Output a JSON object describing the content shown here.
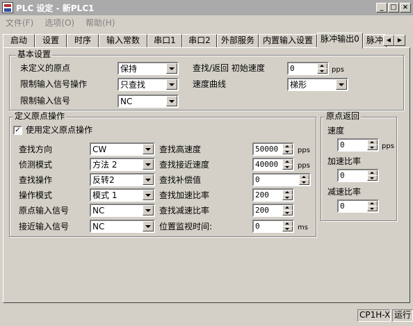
{
  "window": {
    "title": "PLC 设定 - 新PLC1",
    "min_label": "_",
    "max_label": "□",
    "close_label": "×"
  },
  "menu": [
    "文件(F)",
    "选项(O)",
    "帮助(H)"
  ],
  "tabs": [
    "启动",
    "设置",
    "时序",
    "输入常数",
    "串口1",
    "串口2",
    "外部服务",
    "内置输入设置",
    "脉冲输出0",
    "脉冲"
  ],
  "basic": {
    "legend": "基本设置",
    "undefined_origin_label": "未定义的原点",
    "undefined_origin_value": "保持",
    "limit_op_label": "限制输入信号操作",
    "limit_op_value": "只查找",
    "limit_signal_label": "限制输入信号",
    "limit_signal_value": "NC",
    "search_return_label": "查找/返回 初始速度",
    "search_return_value": "0",
    "search_return_unit": "pps",
    "speed_curve_label": "速度曲线",
    "speed_curve_value": "梯形"
  },
  "define": {
    "legend": "定义原点操作",
    "use_check_label": "使用定义原点操作",
    "use_check_mark": "✓",
    "rows": [
      {
        "label": "查找方向",
        "value": "CW"
      },
      {
        "label": "侦测模式",
        "value": "方法 2"
      },
      {
        "label": "查找操作",
        "value": "反转2"
      },
      {
        "label": "操作模式",
        "value": "模式 1"
      },
      {
        "label": "原点输入信号",
        "value": "NC"
      },
      {
        "label": "接近输入信号",
        "value": "NC"
      }
    ],
    "params": [
      {
        "label": "查找高速度",
        "value": "50000",
        "unit": "pps"
      },
      {
        "label": "查找接近速度",
        "value": "40000",
        "unit": "pps"
      },
      {
        "label": "查找补偿值",
        "value": "0",
        "unit": ""
      },
      {
        "label": "查找加速比率",
        "value": "200",
        "unit": ""
      },
      {
        "label": "查找减速比率",
        "value": "200",
        "unit": ""
      },
      {
        "label": "位置监视时间:",
        "value": "0",
        "unit": "ms"
      }
    ]
  },
  "origin_return": {
    "legend": "原点返回",
    "speed_label": "速度",
    "speed_value": "0",
    "speed_unit": "pps",
    "accel_label": "加速比率",
    "accel_value": "0",
    "decel_label": "减速比率",
    "decel_value": "0"
  },
  "status": {
    "model": "CP1H-X",
    "mode": "运行"
  },
  "icons": {
    "app": "plc-app-icon",
    "scroll_left": "◀",
    "scroll_right": "▶"
  }
}
